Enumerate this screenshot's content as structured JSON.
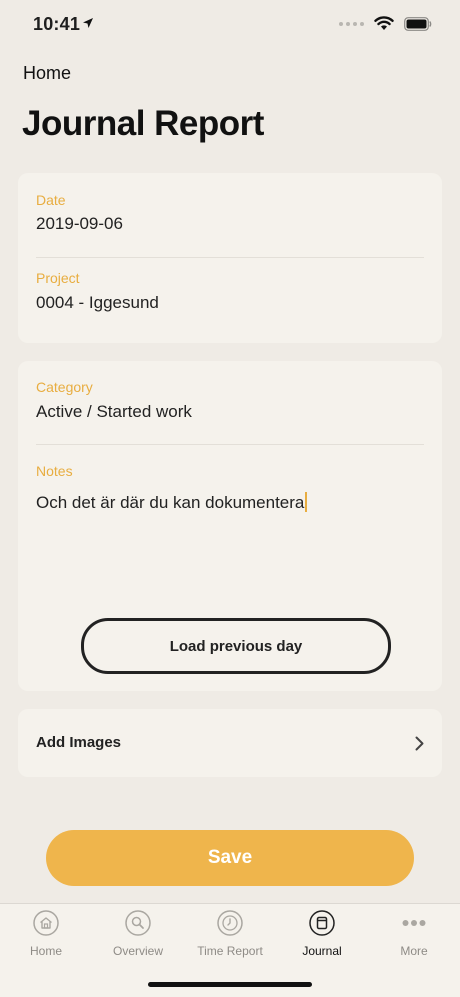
{
  "status": {
    "time": "10:41"
  },
  "nav": {
    "back_label": "Home"
  },
  "page": {
    "title": "Journal Report"
  },
  "form": {
    "date": {
      "label": "Date",
      "value": "2019-09-06"
    },
    "project": {
      "label": "Project",
      "value": "0004 - Iggesund"
    },
    "category": {
      "label": "Category",
      "value": "Active / Started work"
    },
    "notes": {
      "label": "Notes",
      "value": "Och det är där du kan dokumentera"
    },
    "load_previous_label": "Load previous day",
    "add_images_label": "Add Images",
    "save_label": "Save"
  },
  "tabs": [
    {
      "label": "Home",
      "icon": "home-icon",
      "active": false
    },
    {
      "label": "Overview",
      "icon": "search-icon",
      "active": false
    },
    {
      "label": "Time Report",
      "icon": "clock-icon",
      "active": false
    },
    {
      "label": "Journal",
      "icon": "journal-icon",
      "active": true
    },
    {
      "label": "More",
      "icon": "more-icon",
      "active": false
    }
  ],
  "colors": {
    "accent": "#efb54c",
    "label": "#e8ad40",
    "background": "#efebe5",
    "card": "#f5f2ec"
  }
}
